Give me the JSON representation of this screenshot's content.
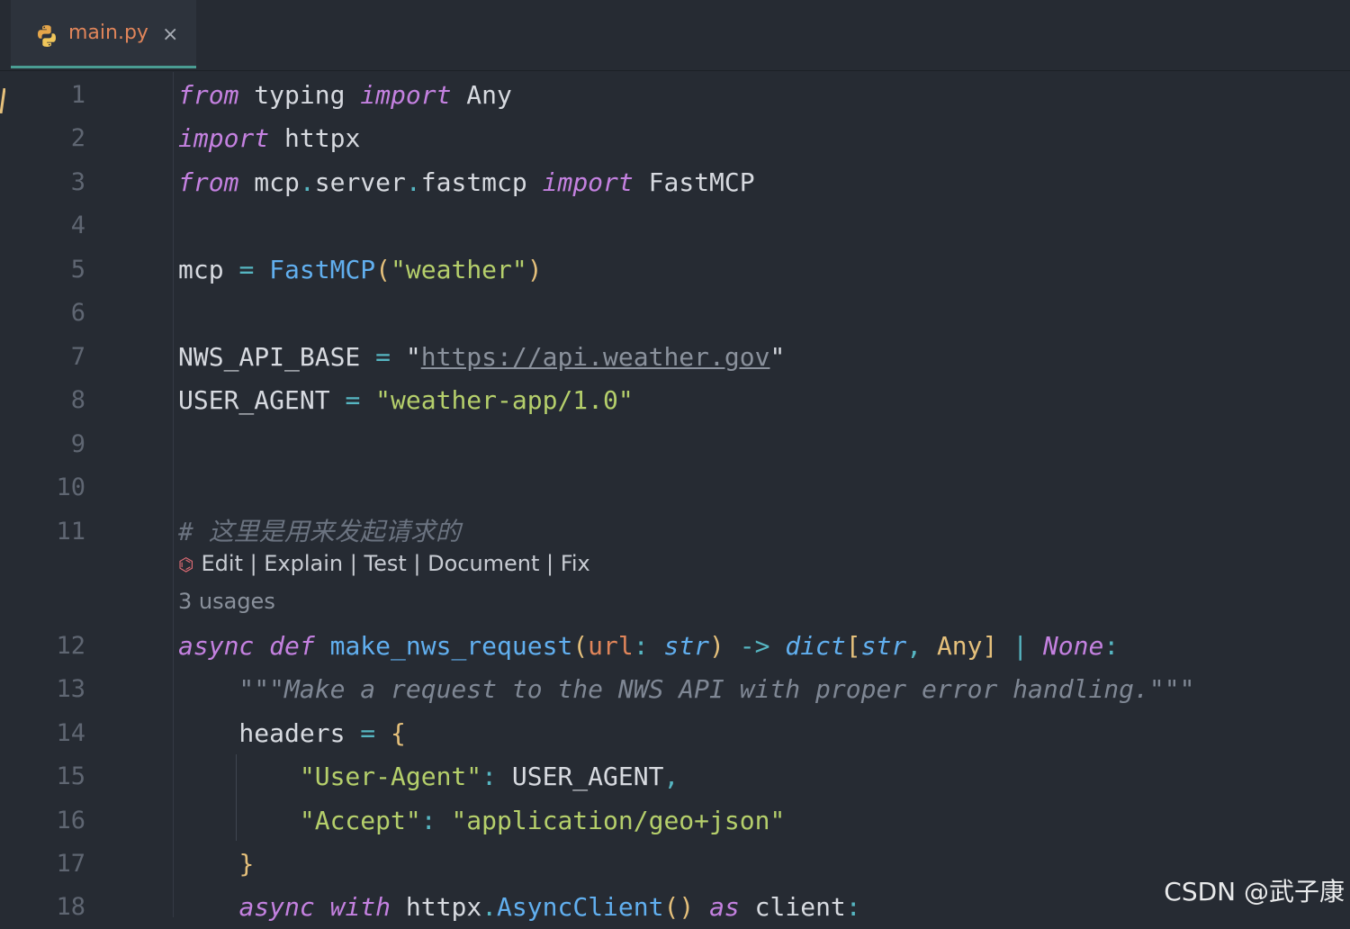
{
  "tab": {
    "filename": "main.py",
    "close_glyph": "×",
    "icon": "python-icon"
  },
  "colors": {
    "background": "#262b33",
    "tab_active": "#2d333c",
    "tab_underline": "#4a9d93"
  },
  "lines": [
    {
      "n": "1",
      "tokens": [
        [
          "kw",
          "from"
        ],
        [
          "plain",
          " typing "
        ],
        [
          "kw",
          "import"
        ],
        [
          "plain",
          " Any"
        ]
      ]
    },
    {
      "n": "2",
      "tokens": [
        [
          "kw",
          "import"
        ],
        [
          "plain",
          " httpx"
        ]
      ]
    },
    {
      "n": "3",
      "tokens": [
        [
          "kw",
          "from"
        ],
        [
          "plain",
          " mcp"
        ],
        [
          "op",
          "."
        ],
        [
          "plain",
          "server"
        ],
        [
          "op",
          "."
        ],
        [
          "plain",
          "fastmcp "
        ],
        [
          "kw",
          "import"
        ],
        [
          "plain",
          " FastMCP"
        ]
      ]
    },
    {
      "n": "4",
      "tokens": []
    },
    {
      "n": "5",
      "tokens": [
        [
          "plain",
          "mcp "
        ],
        [
          "op",
          "="
        ],
        [
          "plain",
          " "
        ],
        [
          "fn",
          "FastMCP"
        ],
        [
          "par",
          "("
        ],
        [
          "str",
          "\"weather\""
        ],
        [
          "par",
          ")"
        ]
      ]
    },
    {
      "n": "6",
      "tokens": []
    },
    {
      "n": "7",
      "tokens": [
        [
          "plain",
          "NWS_API_BASE "
        ],
        [
          "op",
          "="
        ],
        [
          "plain",
          " "
        ],
        [
          "plain",
          "\""
        ],
        [
          "url",
          "https://api.weather.gov"
        ],
        [
          "plain",
          "\""
        ]
      ]
    },
    {
      "n": "8",
      "tokens": [
        [
          "plain",
          "USER_AGENT "
        ],
        [
          "op",
          "="
        ],
        [
          "plain",
          " "
        ],
        [
          "str",
          "\"weather-app/1.0\""
        ]
      ]
    },
    {
      "n": "9",
      "tokens": []
    },
    {
      "n": "10",
      "tokens": []
    },
    {
      "n": "11",
      "tokens": [
        [
          "cm",
          "# 这里是用来发起请求的"
        ]
      ]
    },
    {
      "n": "12",
      "tokens": [
        [
          "kw",
          "async"
        ],
        [
          "plain",
          " "
        ],
        [
          "kw",
          "def"
        ],
        [
          "plain",
          " "
        ],
        [
          "fn",
          "make_nws_request"
        ],
        [
          "par",
          "("
        ],
        [
          "param",
          "url"
        ],
        [
          "op",
          ":"
        ],
        [
          "plain",
          " "
        ],
        [
          "ty",
          "str"
        ],
        [
          "par",
          ")"
        ],
        [
          "plain",
          " "
        ],
        [
          "op",
          "->"
        ],
        [
          "plain",
          " "
        ],
        [
          "ty",
          "dict"
        ],
        [
          "par",
          "["
        ],
        [
          "ty",
          "str"
        ],
        [
          "op",
          ","
        ],
        [
          "plain",
          " "
        ],
        [
          "par",
          "Any"
        ],
        [
          "par",
          "]"
        ],
        [
          "plain",
          " "
        ],
        [
          "op",
          "|"
        ],
        [
          "plain",
          " "
        ],
        [
          "none",
          "None"
        ],
        [
          "op",
          ":"
        ]
      ]
    },
    {
      "n": "13",
      "tokens": [
        [
          "doc",
          "    \"\"\"Make a request to the NWS API with proper error handling.\"\"\""
        ]
      ]
    },
    {
      "n": "14",
      "tokens": [
        [
          "plain",
          "    headers "
        ],
        [
          "op",
          "="
        ],
        [
          "plain",
          " "
        ],
        [
          "par",
          "{"
        ]
      ]
    },
    {
      "n": "15",
      "tokens": [
        [
          "plain",
          "        "
        ],
        [
          "str",
          "\"User-Agent\""
        ],
        [
          "op",
          ":"
        ],
        [
          "plain",
          " USER_AGENT"
        ],
        [
          "op",
          ","
        ]
      ]
    },
    {
      "n": "16",
      "tokens": [
        [
          "plain",
          "        "
        ],
        [
          "str",
          "\"Accept\""
        ],
        [
          "op",
          ":"
        ],
        [
          "plain",
          " "
        ],
        [
          "str",
          "\"application/geo+json\""
        ]
      ]
    },
    {
      "n": "17",
      "tokens": [
        [
          "plain",
          "    "
        ],
        [
          "par",
          "}"
        ]
      ]
    },
    {
      "n": "18",
      "tokens": [
        [
          "plain",
          "    "
        ],
        [
          "kw",
          "async"
        ],
        [
          "plain",
          " "
        ],
        [
          "kw",
          "with"
        ],
        [
          "plain",
          " httpx"
        ],
        [
          "op",
          "."
        ],
        [
          "fn",
          "AsyncClient"
        ],
        [
          "par",
          "()"
        ],
        [
          "plain",
          " "
        ],
        [
          "kw",
          "as"
        ],
        [
          "plain",
          " client"
        ],
        [
          "op",
          ":"
        ]
      ]
    }
  ],
  "inlay": {
    "actions": "Edit | Explain | Test | Document | Fix",
    "usages": "3 usages"
  },
  "watermark": "CSDN @武子康"
}
